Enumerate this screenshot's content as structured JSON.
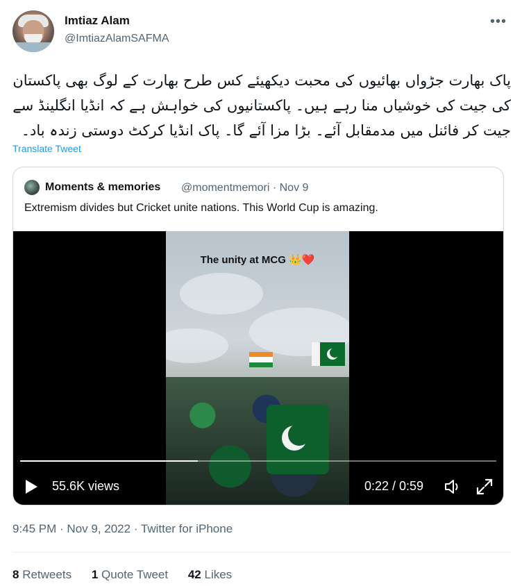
{
  "author": {
    "name": "Imtiaz Alam",
    "handle": "@ImtiazAlamSAFMA"
  },
  "menu_icon": "more-icon",
  "tweet": {
    "text": "پاک بھارت جڑواں بھائیوں کی محبت دیکھیئے کس طرح بھارت کے لوگ بھی پاکستان کی جیت کی خوشیاں منا رہے ہیں۔ پاکستانیوں کی خواہش ہے کہ انڈیا انگلینڈ سے جیت کر فائنل میں مدمقابل آئے۔ بڑا مزا آئے گا۔ پاک انڈیا کرکٹ دوستی زندہ باد۔",
    "translate_label": "Translate Tweet"
  },
  "quote": {
    "name": "Moments & memories",
    "handle": "@momentmemori",
    "separator": "·",
    "date": "Nov 9",
    "text": "Extremism divides but Cricket unite nations. This World Cup is amazing."
  },
  "video": {
    "caption": "The unity at MCG 👑❤️",
    "views": "55.6K views",
    "time": "0:22 / 0:59",
    "progress": 0.373,
    "play_icon": "play-icon",
    "volume_icon": "volume-icon",
    "fullscreen_icon": "fullscreen-icon"
  },
  "meta": {
    "timestamp": "9:45 PM · Nov 9, 2022 · Twitter for iPhone"
  },
  "stats": {
    "retweets_count": "8",
    "retweets_label": "Retweets",
    "quotes_count": "1",
    "quotes_label": "Quote Tweet",
    "likes_count": "42",
    "likes_label": "Likes"
  },
  "colors": {
    "link": "#1d9bf0",
    "secondary": "#536471",
    "text": "#0f1419",
    "border": "#cfd9de"
  }
}
